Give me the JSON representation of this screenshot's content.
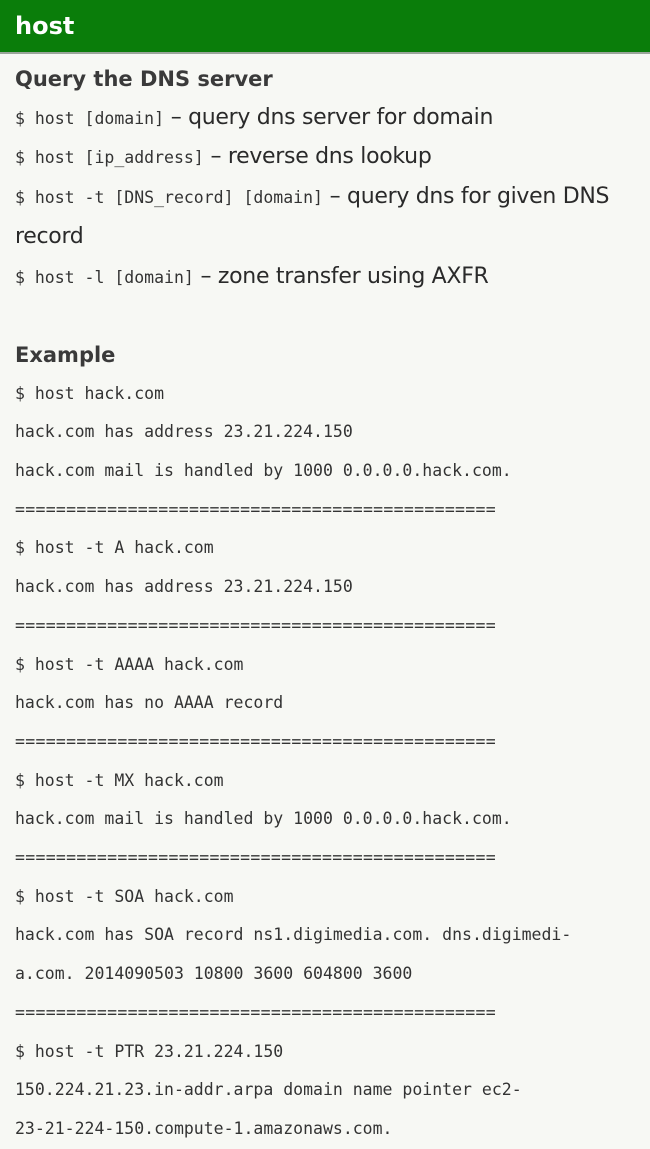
{
  "header": {
    "title": "host"
  },
  "section1": {
    "heading": "Query the DNS server",
    "items": [
      {
        "cmd": "$ host [domain]",
        "desc": " – query dns server for domain"
      },
      {
        "cmd": "$ host [ip_address]",
        "desc": " – reverse dns lookup"
      },
      {
        "cmd": "$ host -t [DNS_record] [domain]",
        "desc": " – query dns for given DNS record"
      },
      {
        "cmd": "$ host -l [domain]",
        "desc": " – zone transfer using AXFR"
      }
    ]
  },
  "section2": {
    "heading": "Example",
    "lines": [
      "$ host hack.com",
      "hack.com has address 23.21.224.150",
      "hack.com mail is handled by 1000 0.0.0.0.hack.com.",
      "===============================================",
      "$ host -t A hack.com",
      "hack.com has address 23.21.224.150",
      "===============================================",
      "$ host -t AAAA hack.com",
      "hack.com has no AAAA record",
      "===============================================",
      "$ host -t MX hack.com",
      "hack.com mail is handled by 1000 0.0.0.0.hack.com.",
      "===============================================",
      "$ host -t SOA hack.com",
      "hack.com has SOA record ns1.digimedia.com. dns.digimedi-",
      "a.com. 2014090503 10800 3600 604800 3600",
      "===============================================",
      "$ host -t PTR 23.21.224.150",
      "150.224.21.23.in-addr.arpa domain name pointer ec2-",
      "23-21-224-150.compute-1.amazonaws.com."
    ]
  }
}
